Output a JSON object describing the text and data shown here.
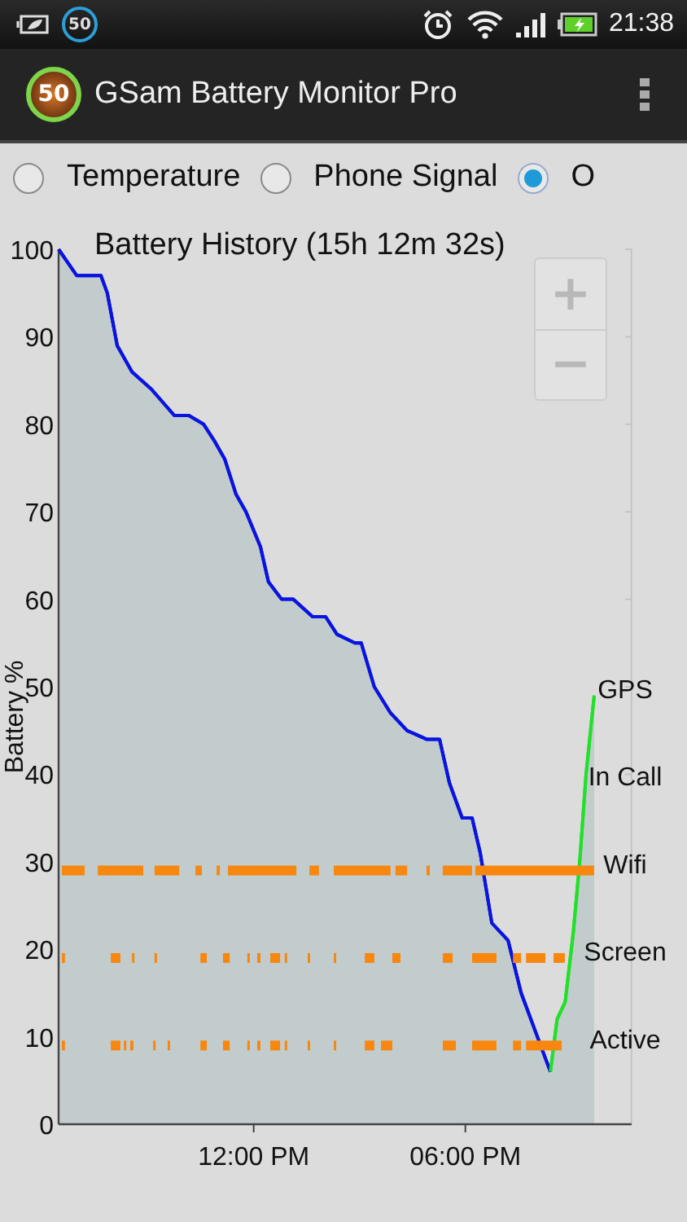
{
  "status_bar": {
    "notification_badge": "50",
    "time": "21:38"
  },
  "app_bar": {
    "icon_badge": "50",
    "title": "GSam Battery Monitor Pro"
  },
  "radio_options": [
    {
      "label": "Temperature",
      "selected": false
    },
    {
      "label": "Phone Signal",
      "selected": false
    },
    {
      "label": "O",
      "selected": true
    }
  ],
  "chart": {
    "chart_data": {
      "type": "area",
      "title": "Battery History (15h 12m 32s)",
      "ylabel": "Battery %",
      "xlim": [
        6.47,
        22.71
      ],
      "ylim": [
        0,
        100
      ],
      "x": [
        6.47,
        6.98,
        7.67,
        7.85,
        8.13,
        8.55,
        9.1,
        9.75,
        10.16,
        10.58,
        10.9,
        11.18,
        11.5,
        11.78,
        12.19,
        12.42,
        12.79,
        13.12,
        13.67,
        14.04,
        14.36,
        14.87,
        15.05,
        15.42,
        15.88,
        16.35,
        16.9,
        17.27,
        17.55,
        17.91,
        18.19,
        18.42,
        18.75,
        19.21,
        19.58,
        20.04,
        20.41,
        20.6,
        20.83,
        21.06,
        21.24,
        21.42,
        21.65
      ],
      "series": [
        {
          "color": "#0a14e0",
          "values": [
            100,
            97,
            97,
            95,
            89,
            86,
            84,
            81,
            81,
            80,
            78,
            76,
            72,
            70,
            66,
            62,
            60,
            60,
            58,
            58,
            56,
            55,
            55,
            50,
            47,
            45,
            44,
            44,
            39,
            35,
            35,
            31,
            23,
            21,
            15,
            10,
            6,
            null,
            null,
            null,
            null,
            null,
            null
          ]
        },
        {
          "color": "#22e02a",
          "values": [
            null,
            null,
            null,
            null,
            null,
            null,
            null,
            null,
            null,
            null,
            null,
            null,
            null,
            null,
            null,
            null,
            null,
            null,
            null,
            null,
            null,
            null,
            null,
            null,
            null,
            null,
            null,
            null,
            null,
            null,
            null,
            null,
            null,
            null,
            null,
            null,
            6,
            12,
            14,
            22,
            30,
            40,
            49
          ]
        }
      ],
      "xticks": [
        {
          "value": 12,
          "label": "12:00 PM"
        },
        {
          "value": 18,
          "label": "06:00 PM"
        }
      ],
      "yticks": [
        0,
        10,
        20,
        30,
        40,
        50,
        60,
        70,
        80,
        90,
        100
      ]
    },
    "activity": [
      {
        "label": "GPS"
      },
      {
        "label": "In Call"
      },
      {
        "label": "Wifi"
      },
      {
        "label": "Screen"
      },
      {
        "label": "Active"
      }
    ],
    "zoom_controls": {
      "zoom_in": "+",
      "zoom_out": "−"
    }
  }
}
